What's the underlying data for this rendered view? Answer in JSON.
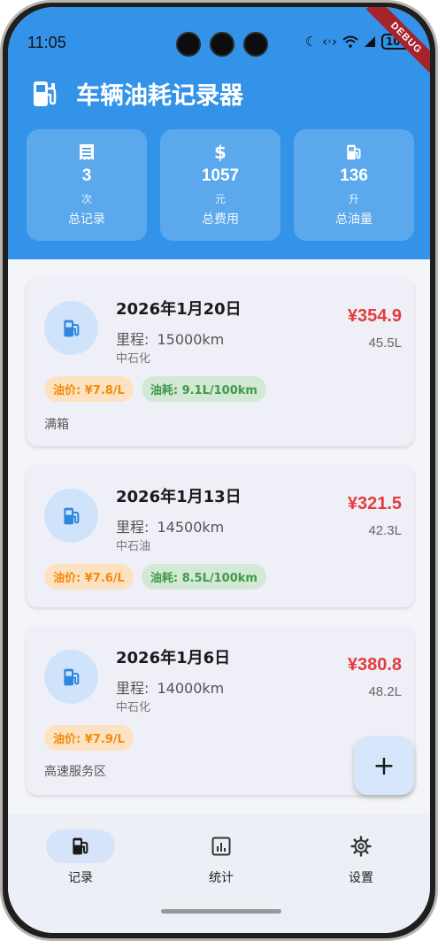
{
  "status_bar": {
    "time": "11:05",
    "icons": [
      "moon-icon",
      "data-arrows-icon",
      "wifi-icon",
      "signal-icon",
      "battery-icon"
    ],
    "battery": "100",
    "debug_banner": "DEBUG"
  },
  "app": {
    "title": "车辆油耗记录器",
    "primary_color": "#3393e8",
    "accent_red": "#e53c3c"
  },
  "stats": [
    {
      "icon": "receipt-icon",
      "value": "3",
      "unit": "次",
      "label": "总记录"
    },
    {
      "icon": "dollar-icon",
      "value": "1057",
      "unit": "元",
      "label": "总费用"
    },
    {
      "icon": "fuel-pump-icon",
      "value": "136",
      "unit": "升",
      "label": "总油量"
    }
  ],
  "records": [
    {
      "date": "2026年1月20日",
      "mileage_label": "里程:",
      "mileage": "15000km",
      "station": "中石化",
      "cost": "¥354.9",
      "liters": "45.5L",
      "price_chip": "油价: ¥7.8/L",
      "consumption_chip": "油耗: 9.1L/100km",
      "note": "满箱"
    },
    {
      "date": "2026年1月13日",
      "mileage_label": "里程:",
      "mileage": "14500km",
      "station": "中石油",
      "cost": "¥321.5",
      "liters": "42.3L",
      "price_chip": "油价: ¥7.6/L",
      "consumption_chip": "油耗: 8.5L/100km",
      "note": ""
    },
    {
      "date": "2026年1月6日",
      "mileage_label": "里程:",
      "mileage": "14000km",
      "station": "中石化",
      "cost": "¥380.8",
      "liters": "48.2L",
      "price_chip": "油价: ¥7.9/L",
      "consumption_chip": "",
      "note": "高速服务区"
    }
  ],
  "fab": {
    "symbol": "+"
  },
  "bottom_nav": [
    {
      "label": "记录",
      "icon": "fuel-pump-icon",
      "active": true
    },
    {
      "label": "统计",
      "icon": "chart-icon",
      "active": false
    },
    {
      "label": "设置",
      "icon": "gear-icon",
      "active": false
    }
  ]
}
